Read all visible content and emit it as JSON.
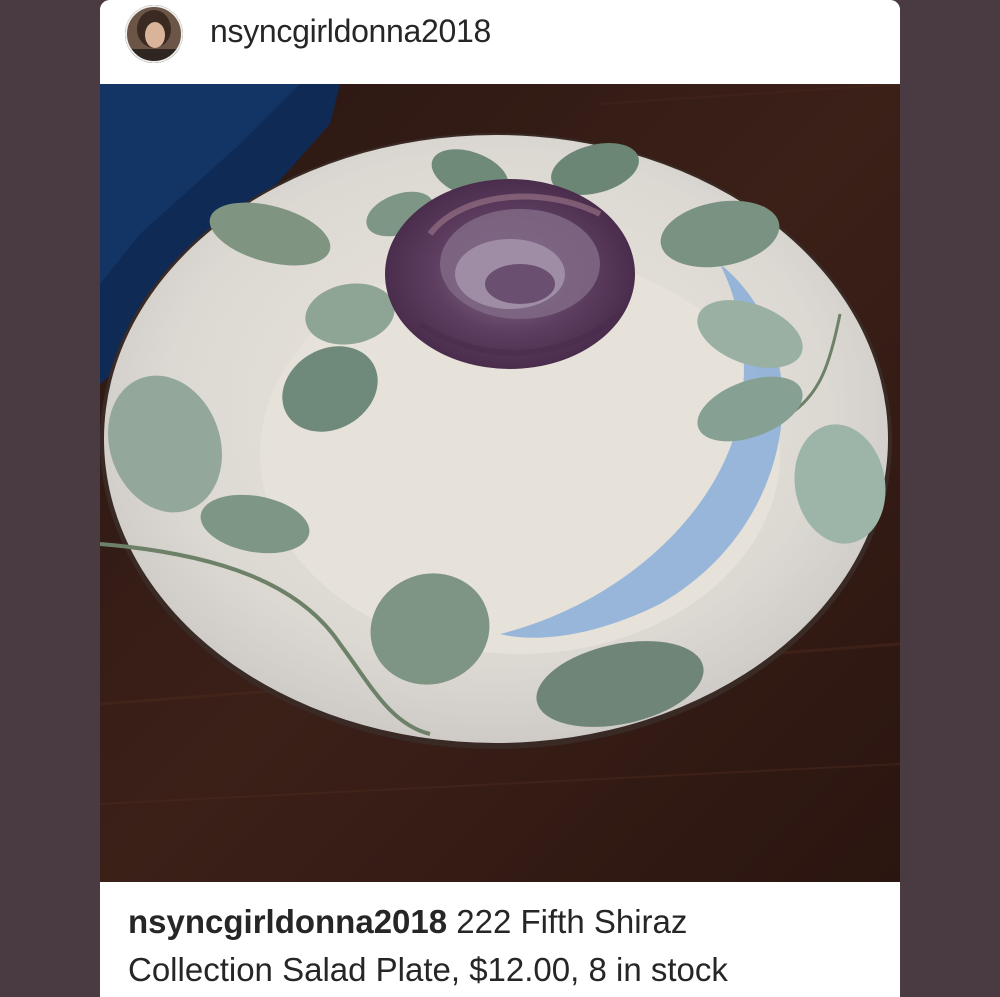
{
  "post": {
    "username": "nsyncgirldonna2018",
    "caption_username": "nsyncgirldonna2018",
    "caption_line1": " 222 Fifth Shiraz",
    "caption_line2": "Collection Salad Plate, $12.00, 8 in stock"
  },
  "icons": {
    "avatar": "profile-photo"
  },
  "colors": {
    "background": "#4a3b42",
    "card": "#ffffff",
    "text": "#262626"
  }
}
